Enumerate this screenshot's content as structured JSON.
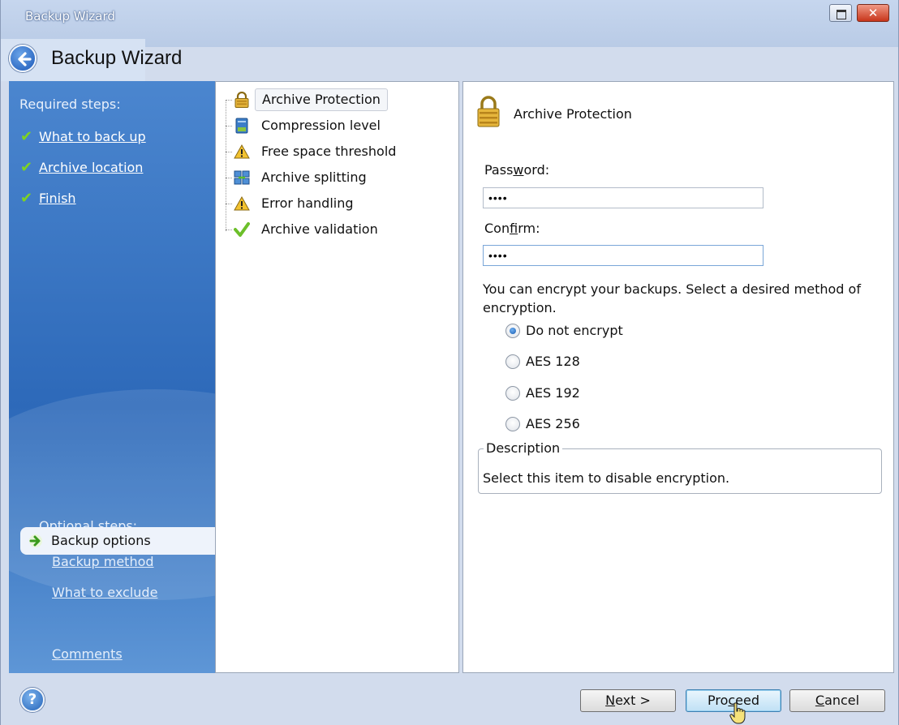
{
  "window": {
    "title": "Backup Wizard"
  },
  "header": {
    "title": "Backup Wizard"
  },
  "sidebar": {
    "required_heading": "Required steps:",
    "required": [
      {
        "label": "What to back up"
      },
      {
        "label": "Archive location"
      },
      {
        "label": "Finish"
      }
    ],
    "optional_heading": "Optional steps:",
    "optional": [
      {
        "label": "Backup method"
      },
      {
        "label": "What to exclude"
      },
      {
        "label": "Backup options"
      },
      {
        "label": "Comments"
      }
    ],
    "selected": "Backup options"
  },
  "tree": {
    "items": [
      {
        "label": "Archive Protection",
        "icon": "lock-icon"
      },
      {
        "label": "Compression level",
        "icon": "compression-icon"
      },
      {
        "label": "Free space threshold",
        "icon": "warning-icon"
      },
      {
        "label": "Archive splitting",
        "icon": "split-icon"
      },
      {
        "label": "Error handling",
        "icon": "warning-icon"
      },
      {
        "label": "Archive validation",
        "icon": "check-icon"
      }
    ],
    "selected": "Archive Protection"
  },
  "panel": {
    "title": "Archive Protection",
    "password_label_pre": "Pass",
    "password_label_key": "w",
    "password_label_post": "ord:",
    "password_value": "••••",
    "confirm_label_pre": "Con",
    "confirm_label_key": "f",
    "confirm_label_post": "irm:",
    "confirm_value": "••••",
    "encrypt_text": "You can encrypt your backups. Select a desired method of encryption.",
    "options": [
      {
        "label": "Do not encrypt",
        "checked": true
      },
      {
        "label": "AES 128",
        "checked": false
      },
      {
        "label": "AES 192",
        "checked": false
      },
      {
        "label": "AES 256",
        "checked": false
      }
    ],
    "description_legend": "Description",
    "description_text": "Select this item to disable encryption."
  },
  "footer": {
    "help": "?",
    "next_key": "N",
    "next_rest": "ext >",
    "proceed_pre": "Pro",
    "proceed_key": "c",
    "proceed_post": "eed",
    "cancel_key": "C",
    "cancel_rest": "ancel"
  }
}
